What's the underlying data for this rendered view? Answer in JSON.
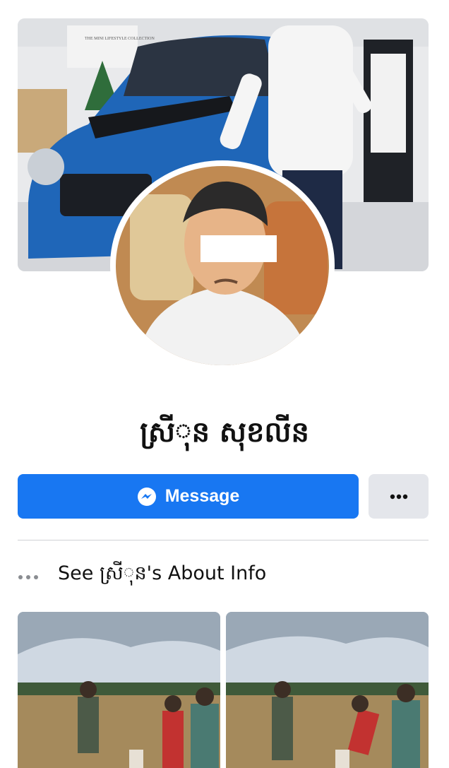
{
  "profile": {
    "name": "ស្រី​ុន សុខលីន",
    "message_label": "Message",
    "about_label": "See ស្រី​ុន's About Info"
  },
  "cover": {
    "sign_text": "THE MINI LIFESTYLE COLLECTION"
  },
  "icons": {
    "messenger": "messenger-icon",
    "more": "more-horizontal-icon",
    "about": "more-dots-icon"
  },
  "colors": {
    "primary": "#1877f2",
    "secondary_bg": "#e4e6eb",
    "text": "#111111"
  }
}
